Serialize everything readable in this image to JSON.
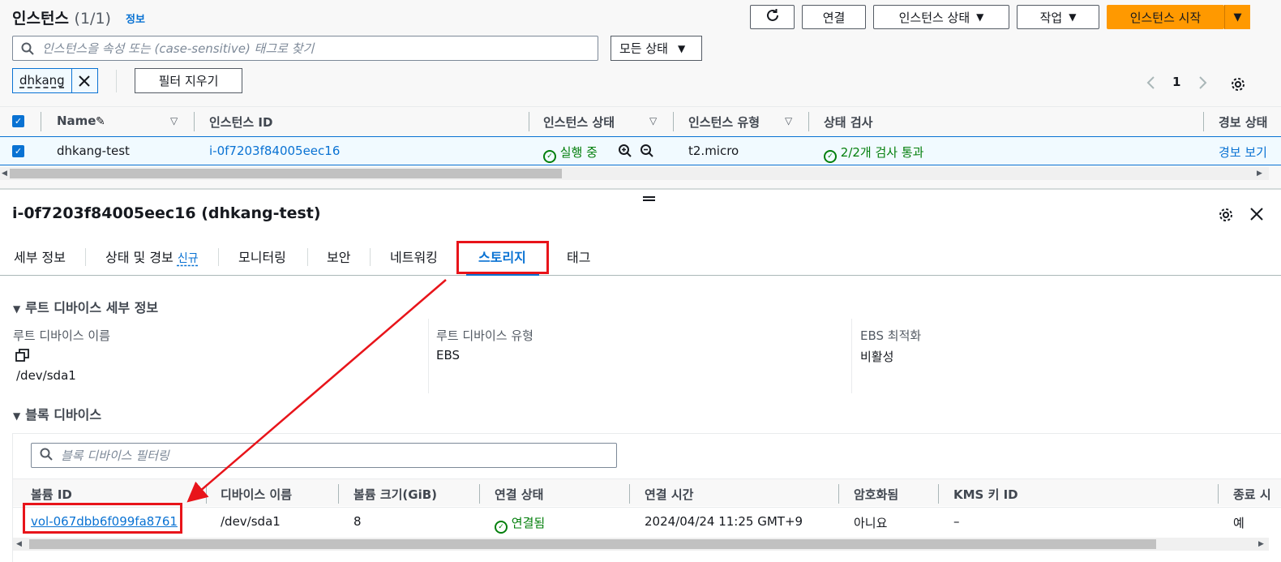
{
  "header": {
    "title": "인스턴스",
    "count": "(1/1)",
    "info": "정보",
    "buttons": {
      "connect": "연결",
      "instance_state": "인스턴스 상태",
      "actions": "작업",
      "launch": "인스턴스 시작"
    }
  },
  "search": {
    "placeholder": "인스턴스을 속성 또는 (case-sensitive) 태그로 찾기"
  },
  "state_filter": {
    "selected": "모든 상태"
  },
  "filter_token": {
    "label": "dhkang"
  },
  "clear_filters": "필터 지우기",
  "pagination": {
    "page": "1"
  },
  "table": {
    "columns": [
      "Name",
      "인스턴스 ID",
      "인스턴스 상태",
      "인스턴스 유형",
      "상태 검사",
      "경보 상태"
    ],
    "rows": [
      {
        "name": "dhkang-test",
        "id": "i-0f7203f84005eec16",
        "state": "실행 중",
        "type": "t2.micro",
        "check": "2/2개 검사 통과",
        "alarm": "경보 보기"
      }
    ]
  },
  "detail": {
    "title": "i-0f7203f84005eec16 (dhkang-test)",
    "tabs": [
      {
        "label": "세부 정보"
      },
      {
        "label": "상태 및 경보",
        "badge": "신규"
      },
      {
        "label": "모니터링"
      },
      {
        "label": "보안"
      },
      {
        "label": "네트워킹"
      },
      {
        "label": "스토리지"
      },
      {
        "label": "태그"
      }
    ],
    "root_section": "루트 디바이스 세부 정보",
    "root": {
      "name_label": "루트 디바이스 이름",
      "name_value": "/dev/sda1",
      "type_label": "루트 디바이스 유형",
      "type_value": "EBS",
      "ebs_label": "EBS 최적화",
      "ebs_value": "비활성"
    },
    "block_section": "블록 디바이스",
    "block_search_placeholder": "블록 디바이스 필터링",
    "block_columns": [
      "볼륨 ID",
      "디바이스 이름",
      "볼륨 크기(GiB)",
      "연결 상태",
      "연결 시간",
      "암호화됨",
      "KMS 키 ID",
      "종료 시"
    ],
    "block_rows": [
      {
        "volume_id": "vol-067dbb6f099fa8761",
        "device": "/dev/sda1",
        "size": "8",
        "status": "연결됨",
        "time": "2024/04/24 11:25 GMT+9",
        "encrypted": "아니요",
        "kms": "–",
        "delete": "예"
      }
    ]
  },
  "colors": {
    "accent": "#0972d3",
    "primary": "#ff9900",
    "success": "#037f0c",
    "highlight": "#e8141a"
  }
}
